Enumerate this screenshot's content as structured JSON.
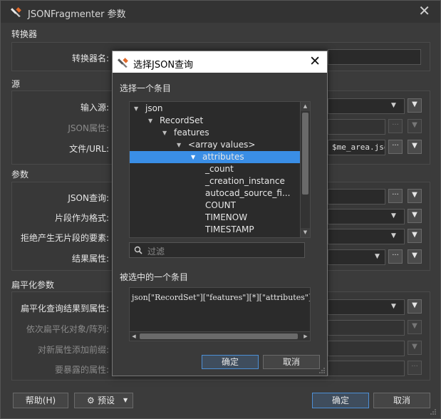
{
  "window": {
    "title": "JSONFragmenter 参数",
    "icon": "fme-wrench-icon"
  },
  "sections": {
    "transformer": "转换器",
    "source": "源",
    "parameters": "参数",
    "flatten": "扁平化参数"
  },
  "transformer": {
    "name_label": "转换器名:"
  },
  "source": {
    "input_source_label": "输入源:",
    "json_attr_label": "JSON属性:",
    "file_url_label": "文件/URL:",
    "file_url_value": "$me_area.json"
  },
  "params": {
    "json_query_label": "JSON查询:",
    "fragment_format_label": "片段作为格式:",
    "reject_label": "拒绝产生无片段的要素:",
    "result_attr_label": "结果属性:"
  },
  "flatten": {
    "flatten_query_label": "扁平化查询结果到属性:",
    "recursive_label": "依次扁平化对象/阵列:",
    "prefix_label": "对新属性添加前缀:",
    "exposed_label": "要暴露的属性:"
  },
  "footer": {
    "help_label": "帮助(H)",
    "presets_label": "预设",
    "ok_label": "确定",
    "cancel_label": "取消"
  },
  "dialog": {
    "title": "选择JSON查询",
    "select_item_label": "选择一个条目",
    "filter_placeholder": "过滤",
    "selected_label": "被选中的一个条目",
    "selected_value": "json[\"RecordSet\"][\"features\"][*][\"attributes\"]",
    "ok_label": "确定",
    "cancel_label": "取消",
    "tree": [
      {
        "label": "json",
        "depth": 0,
        "expanded": true
      },
      {
        "label": "RecordSet",
        "depth": 1,
        "expanded": true
      },
      {
        "label": "features",
        "depth": 2,
        "expanded": true
      },
      {
        "label": "<array values>",
        "depth": 3,
        "expanded": true
      },
      {
        "label": "attributes",
        "depth": 4,
        "expanded": true,
        "selected": true
      },
      {
        "label": "_count",
        "depth": 5
      },
      {
        "label": "_creation_instance",
        "depth": 5
      },
      {
        "label": "autocad_source_fi...",
        "depth": 5
      },
      {
        "label": "COUNT",
        "depth": 5
      },
      {
        "label": "TIMENOW",
        "depth": 5
      },
      {
        "label": "TIMESTAMP",
        "depth": 5
      }
    ]
  },
  "colors": {
    "selection": "#3a8ee6",
    "primary_border": "#4d8fd6"
  }
}
